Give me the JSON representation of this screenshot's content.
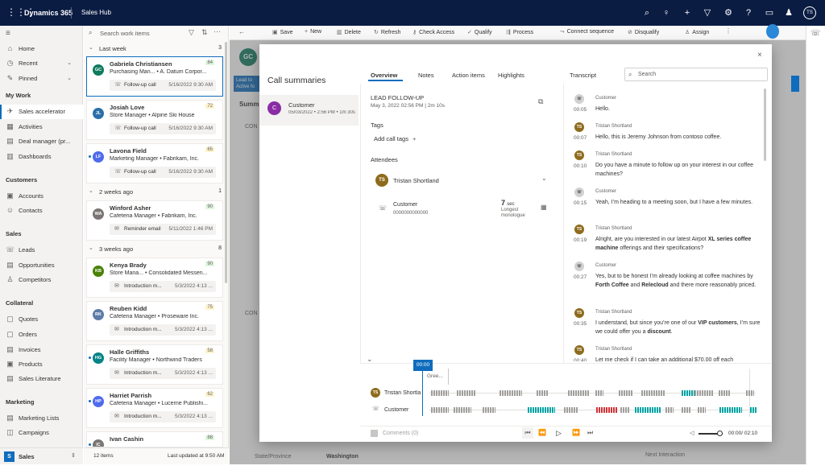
{
  "topbar": {
    "brand": "Dynamics 365",
    "app": "Sales Hub",
    "user_initials": "TS"
  },
  "nav": {
    "home": "Home",
    "recent": "Recent",
    "pinned": "Pinned",
    "my_work_header": "My Work",
    "sales_accelerator": "Sales accelerator",
    "activities": "Activities",
    "deal_manager": "Deal manager (pr...",
    "dashboards": "Dashboards",
    "customers_header": "Customers",
    "accounts": "Accounts",
    "contacts": "Contacts",
    "sales_header": "Sales",
    "leads": "Leads",
    "opportunities": "Opportunities",
    "competitors": "Competitors",
    "collateral_header": "Collateral",
    "quotes": "Quotes",
    "orders": "Orders",
    "invoices": "Invoices",
    "products": "Products",
    "sales_literature": "Sales Literature",
    "marketing_header": "Marketing",
    "marketing_lists": "Marketing Lists",
    "campaigns": "Campaigns",
    "area_badge": "S",
    "area_label": "Sales"
  },
  "worklist": {
    "search_placeholder": "Search work items",
    "groups": [
      {
        "label": "Last week",
        "count": "3"
      },
      {
        "label": "2 weeks ago",
        "count": "1"
      },
      {
        "label": "3 weeks ago",
        "count": "8"
      }
    ],
    "cards": [
      {
        "initials": "GC",
        "color": "#0f7b5f",
        "name": "Gabriela Christiansen",
        "sub": "Purchasing Man... • A. Datum Corpor...",
        "score": "84",
        "action": "Follow-up call",
        "date": "5/16/2022 9:30 AM"
      },
      {
        "initials": "JL",
        "color": "#2b6fa8",
        "name": "Josiah Love",
        "sub": "Store Manager • Alpine Ski House",
        "score": "72",
        "action": "Follow-up call",
        "date": "5/16/2022 9:30 AM"
      },
      {
        "initials": "LF",
        "color": "#4f6bed",
        "name": "Lavona Field",
        "sub": "Marketing Manager • Fabrikam, Inc.",
        "score": "65",
        "action": "Follow-up call",
        "date": "5/16/2022 9:30 AM"
      },
      {
        "initials": "WA",
        "color": "#7a7574",
        "name": "Winford Asher",
        "sub": "Cafeteria Manager • Fabrikam, Inc.",
        "score": "90",
        "action": "Reminder email",
        "date": "5/11/2022 1:46 PM"
      },
      {
        "initials": "KB",
        "color": "#498205",
        "name": "Kenya Brady",
        "sub": "Store Mana... • Consolidated Messen...",
        "score": "90",
        "action": "Introduction m...",
        "date": "5/3/2022 4:13 ..."
      },
      {
        "initials": "RK",
        "color": "#5c7ba8",
        "name": "Reuben Kidd",
        "sub": "Cafeteria Manager • Proseware Inc.",
        "score": "75",
        "action": "Introduction m...",
        "date": "5/3/2022 4:13 ..."
      },
      {
        "initials": "HG",
        "color": "#038387",
        "name": "Halle Griffiths",
        "sub": "Facility Manager • Northwind Traders",
        "score": "58",
        "action": "Introduction m...",
        "date": "5/3/2022 4:13 ..."
      },
      {
        "initials": "HP",
        "color": "#4f6bed",
        "name": "Harriet Parrish",
        "sub": "Cafeteria Manager • Lucerne Publishi...",
        "score": "62",
        "action": "Introduction m...",
        "date": "5/3/2022 4:13 ..."
      },
      {
        "initials": "IC",
        "color": "#7a7574",
        "name": "Ivan Cashin",
        "sub": "",
        "score": "88",
        "action": "",
        "date": ""
      }
    ],
    "footer_count": "12 items",
    "footer_updated": "Last updated at 9:50 AM"
  },
  "toolbar": {
    "save": "Save",
    "new": "New",
    "delete": "Delete",
    "refresh": "Refresh",
    "check_access": "Check Access",
    "qualify": "Qualify",
    "process": "Process",
    "connect_sequence": "Connect sequence",
    "disqualify": "Disqualify",
    "assign": "Assign"
  },
  "background_form": {
    "state_label": "State/Province",
    "state_value": "Washington",
    "next_interaction": "Next Interaction",
    "lead_badge": "Lead to",
    "active_badge": "Active fo",
    "summary_tab": "Summ",
    "section_con": "CON",
    "avatar": "GC"
  },
  "modal": {
    "title": "Call summaries",
    "call_name": "Customer",
    "call_meta": "05/03/2022 • 2:56 PM • 1m 30s",
    "call_initial": "C",
    "tabs": [
      "Overview",
      "Notes",
      "Action items",
      "Highlights"
    ],
    "transcript_tab": "Transcript",
    "search_placeholder": "Search",
    "overview": {
      "title": "LEAD FOLLOW-UP",
      "meta": "May 3, 2022 02:56 PM | 2m 10s",
      "tags_header": "Tags",
      "add_tags": "Add call tags",
      "attendees_header": "Attendees",
      "attendee1_initials": "TS",
      "attendee1_name": "Tristan Shortland",
      "attendee2_name": "Customer",
      "attendee2_phone": "0000000000000",
      "monologue_value": "7",
      "monologue_unit": "sec",
      "monologue_label1": "Longest",
      "monologue_label2": "monologue"
    },
    "transcript": [
      {
        "speaker": "Customer",
        "type": "customer",
        "time": "00:05",
        "text": "Hello."
      },
      {
        "speaker": "Tristan Shortland",
        "type": "agent",
        "time": "00:07",
        "text": "Hello, this is Jeremy Johnson from contoso coffee."
      },
      {
        "speaker": "Tristan Shortland",
        "type": "agent",
        "time": "00:10",
        "text": "Do you have a minute to follow up on your interest in our coffee machines?"
      },
      {
        "speaker": "Customer",
        "type": "customer",
        "time": "00:15",
        "text": "Yeah, I''m heading to a meeting soon, but I have a few minutes."
      },
      {
        "speaker": "Tristan Shortland",
        "type": "agent",
        "time": "00:19",
        "text": "Alright, are you interested in our latest Airpot XL series coffee machine offerings and their specifications?"
      },
      {
        "speaker": "Customer",
        "type": "customer",
        "time": "00:27",
        "text": "Yes, but to be honest I''m already looking at coffee machines by Forth Coffee and Relecloud and there more reasonably priced."
      },
      {
        "speaker": "Tristan Shortland",
        "type": "agent",
        "time": "00:35",
        "text": "I understand, but since you''re one of our VIP customers, I''m sure we could offer you a discount."
      },
      {
        "speaker": "Tristan Shortland",
        "type": "agent",
        "time": "00:40",
        "text": "Let me check if I can take an additional $70.00 off each"
      }
    ],
    "timeline": {
      "playhead": "00:00",
      "segment_label": "Gree...",
      "track1": "Tristan Shortla...",
      "track1_initials": "TS",
      "track2": "Customer",
      "progress": 0.0
    },
    "footer": {
      "comments": "Comments (0)",
      "time": "00:00/ 02:10"
    }
  },
  "colors": {
    "topbar": "#0b1c43",
    "accent": "#0f6cbd",
    "agent_avatar": "#8e6b1c",
    "customer_avatar": "#d1d1d1",
    "track_gray": "#a19f9d",
    "track_teal": "#00a3a3",
    "track_red": "#d13438"
  }
}
